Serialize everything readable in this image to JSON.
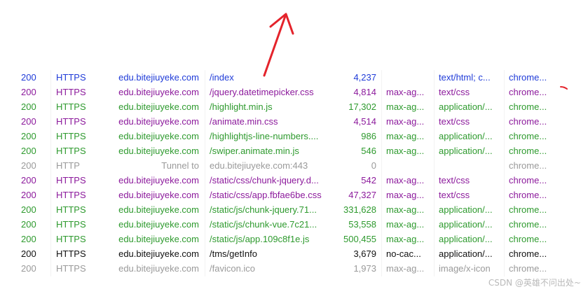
{
  "colors": {
    "blue": "#1f3bd8",
    "purple": "#8c1a9c",
    "green": "#2e9a2e",
    "gray": "#9a9a9a",
    "black": "#111111",
    "annotation_red": "#e4232b"
  },
  "sessions": [
    {
      "result": "200",
      "protocol": "HTTPS",
      "host": "edu.bitejiuyeke.com",
      "url": "/index",
      "body": "4,237",
      "caching": "",
      "content_type": "text/html; c...",
      "process": "chrome...",
      "color": "blue"
    },
    {
      "result": "200",
      "protocol": "HTTPS",
      "host": "edu.bitejiuyeke.com",
      "url": "/jquery.datetimepicker.css",
      "body": "4,814",
      "caching": "max-ag...",
      "content_type": "text/css",
      "process": "chrome...",
      "color": "purple"
    },
    {
      "result": "200",
      "protocol": "HTTPS",
      "host": "edu.bitejiuyeke.com",
      "url": "/highlight.min.js",
      "body": "17,302",
      "caching": "max-ag...",
      "content_type": "application/...",
      "process": "chrome...",
      "color": "green"
    },
    {
      "result": "200",
      "protocol": "HTTPS",
      "host": "edu.bitejiuyeke.com",
      "url": "/animate.min.css",
      "body": "4,514",
      "caching": "max-ag...",
      "content_type": "text/css",
      "process": "chrome...",
      "color": "purple"
    },
    {
      "result": "200",
      "protocol": "HTTPS",
      "host": "edu.bitejiuyeke.com",
      "url": "/highlightjs-line-numbers....",
      "body": "986",
      "caching": "max-ag...",
      "content_type": "application/...",
      "process": "chrome...",
      "color": "green"
    },
    {
      "result": "200",
      "protocol": "HTTPS",
      "host": "edu.bitejiuyeke.com",
      "url": "/swiper.animate.min.js",
      "body": "546",
      "caching": "max-ag...",
      "content_type": "application/...",
      "process": "chrome...",
      "color": "green"
    },
    {
      "result": "200",
      "protocol": "HTTP",
      "host": "Tunnel to",
      "url": "edu.bitejiuyeke.com:443",
      "body": "0",
      "caching": "",
      "content_type": "",
      "process": "chrome...",
      "color": "gray"
    },
    {
      "result": "200",
      "protocol": "HTTPS",
      "host": "edu.bitejiuyeke.com",
      "url": "/static/css/chunk-jquery.d...",
      "body": "542",
      "caching": "max-ag...",
      "content_type": "text/css",
      "process": "chrome...",
      "color": "purple"
    },
    {
      "result": "200",
      "protocol": "HTTPS",
      "host": "edu.bitejiuyeke.com",
      "url": "/static/css/app.fbfae6be.css",
      "body": "47,327",
      "caching": "max-ag...",
      "content_type": "text/css",
      "process": "chrome...",
      "color": "purple"
    },
    {
      "result": "200",
      "protocol": "HTTPS",
      "host": "edu.bitejiuyeke.com",
      "url": "/static/js/chunk-jquery.71...",
      "body": "331,628",
      "caching": "max-ag...",
      "content_type": "application/...",
      "process": "chrome...",
      "color": "green"
    },
    {
      "result": "200",
      "protocol": "HTTPS",
      "host": "edu.bitejiuyeke.com",
      "url": "/static/js/chunk-vue.7c21...",
      "body": "53,558",
      "caching": "max-ag...",
      "content_type": "application/...",
      "process": "chrome...",
      "color": "green"
    },
    {
      "result": "200",
      "protocol": "HTTPS",
      "host": "edu.bitejiuyeke.com",
      "url": "/static/js/app.109c8f1e.js",
      "body": "500,455",
      "caching": "max-ag...",
      "content_type": "application/...",
      "process": "chrome...",
      "color": "green"
    },
    {
      "result": "200",
      "protocol": "HTTPS",
      "host": "edu.bitejiuyeke.com",
      "url": "/tms/getInfo",
      "body": "3,679",
      "caching": "no-cac...",
      "content_type": "application/...",
      "process": "chrome...",
      "color": "black"
    },
    {
      "result": "200",
      "protocol": "HTTPS",
      "host": "edu.bitejiuyeke.com",
      "url": "/favicon.ico",
      "body": "1,973",
      "caching": "max-ag...",
      "content_type": "image/x-icon",
      "process": "chrome...",
      "color": "gray"
    }
  ],
  "watermark": "CSDN @英雄不问出处~",
  "icons": {
    "annotation_arrow": "red-arrow-icon",
    "annotation_mark": "red-pen-mark-icon"
  }
}
